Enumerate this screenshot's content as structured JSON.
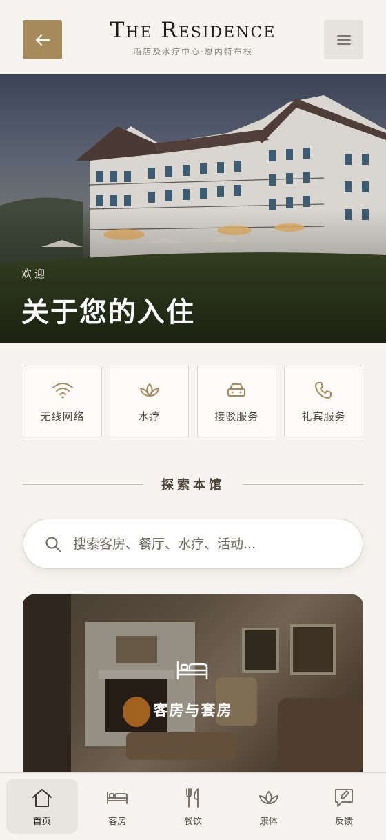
{
  "header": {
    "brand_title": "The Residence",
    "brand_subtitle": "酒店及水疗中心·恩内特布根",
    "back_icon": "arrow-left-icon",
    "menu_icon": "hamburger-menu-icon",
    "accent_color": "#a78a5c"
  },
  "hero": {
    "kicker": "欢迎",
    "title": "关于您的入住"
  },
  "quick_actions": [
    {
      "label": "无线网络",
      "icon": "wifi-icon"
    },
    {
      "label": "水疗",
      "icon": "lotus-icon"
    },
    {
      "label": "接驳服务",
      "icon": "car-icon"
    },
    {
      "label": "礼宾服务",
      "icon": "phone-icon"
    }
  ],
  "explore": {
    "title": "探索本馆"
  },
  "search": {
    "placeholder": "搜索客房、餐厅、水疗、活动..."
  },
  "rooms_card": {
    "label": "客房与套房",
    "icon": "bed-icon"
  },
  "bottom_nav": [
    {
      "label": "首页",
      "icon": "home-icon",
      "active": true
    },
    {
      "label": "客房",
      "icon": "bed-icon",
      "active": false
    },
    {
      "label": "餐饮",
      "icon": "fork-knife-icon",
      "active": false
    },
    {
      "label": "康体",
      "icon": "lotus-icon",
      "active": false
    },
    {
      "label": "反馈",
      "icon": "feedback-icon",
      "active": false
    }
  ]
}
